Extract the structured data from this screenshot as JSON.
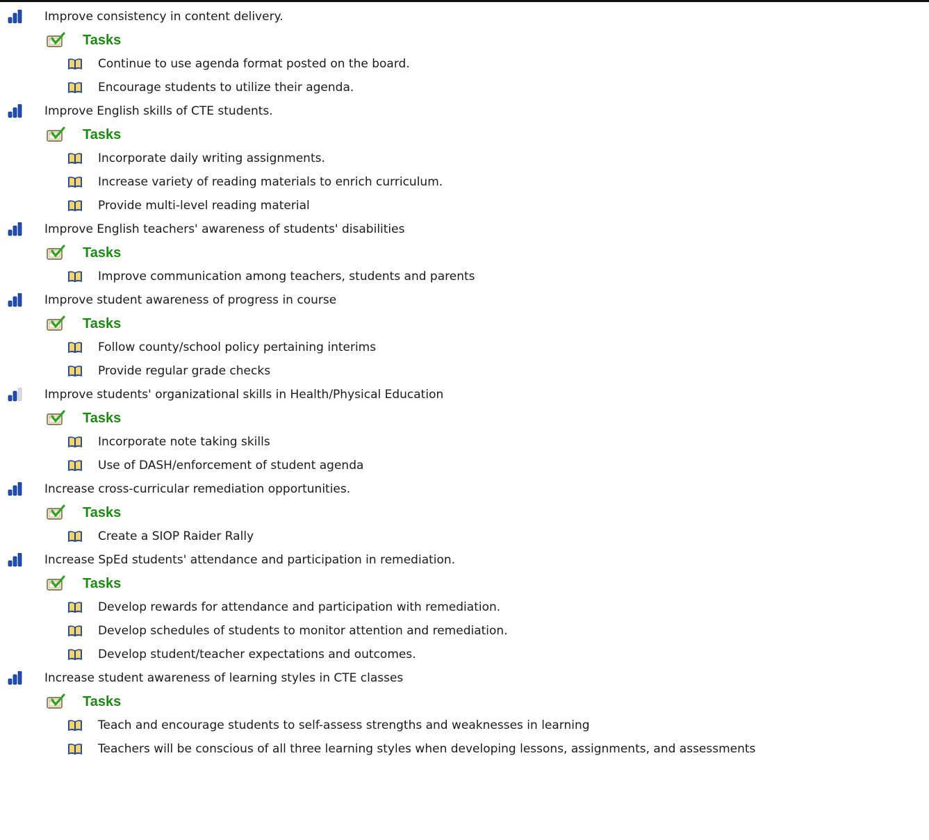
{
  "section_label": "Tasks",
  "goals": [
    {
      "text": "Improve consistency in content delivery.",
      "progress_level": 3,
      "tasks": [
        "Continue to use agenda format posted on the board.",
        "Encourage students to utilize their agenda."
      ]
    },
    {
      "text": "Improve English skills of CTE students.",
      "progress_level": 3,
      "tasks": [
        "Incorporate daily writing assignments.",
        "Increase variety of reading materials to enrich curriculum.",
        "Provide multi-level reading material"
      ]
    },
    {
      "text": "Improve English teachers' awareness of students' disabilities",
      "progress_level": 3,
      "tasks": [
        "Improve communication among teachers, students and parents"
      ]
    },
    {
      "text": "Improve student awareness of progress in course",
      "progress_level": 3,
      "tasks": [
        "Follow county/school policy pertaining interims",
        "Provide regular grade checks"
      ]
    },
    {
      "text": "Improve students' organizational skills in Health/Physical Education",
      "progress_level": 2,
      "tasks": [
        "Incorporate note taking skills",
        "Use of DASH/enforcement of student agenda"
      ]
    },
    {
      "text": "Increase cross-curricular remediation opportunities.",
      "progress_level": 3,
      "tasks": [
        "Create a SIOP Raider Rally"
      ]
    },
    {
      "text": "Increase SpEd students' attendance and participation in remediation.",
      "progress_level": 3,
      "tasks": [
        "Develop rewards for attendance and participation with remediation.",
        "Develop schedules of students to monitor attention and remediation.",
        "Develop student/teacher expectations and outcomes."
      ]
    },
    {
      "text": "Increase student awareness of learning styles in CTE classes",
      "progress_level": 3,
      "tasks": [
        "Teach and encourage students to self-assess strengths and weaknesses in learning",
        "Teachers will be conscious of all three learning styles when developing lessons, assignments, and assessments"
      ]
    }
  ],
  "icons": {
    "goal": "progress-bars-icon",
    "tasks": "task-checklist-icon",
    "task": "open-book-icon"
  },
  "colors": {
    "tasks_label": "#1a8a10",
    "bar_filled": "#1f4fb5",
    "bar_empty": "#d9dde3",
    "book_frame": "#2b4f9a",
    "book_pages": "#f2d66b",
    "check": "#2ea51f"
  }
}
